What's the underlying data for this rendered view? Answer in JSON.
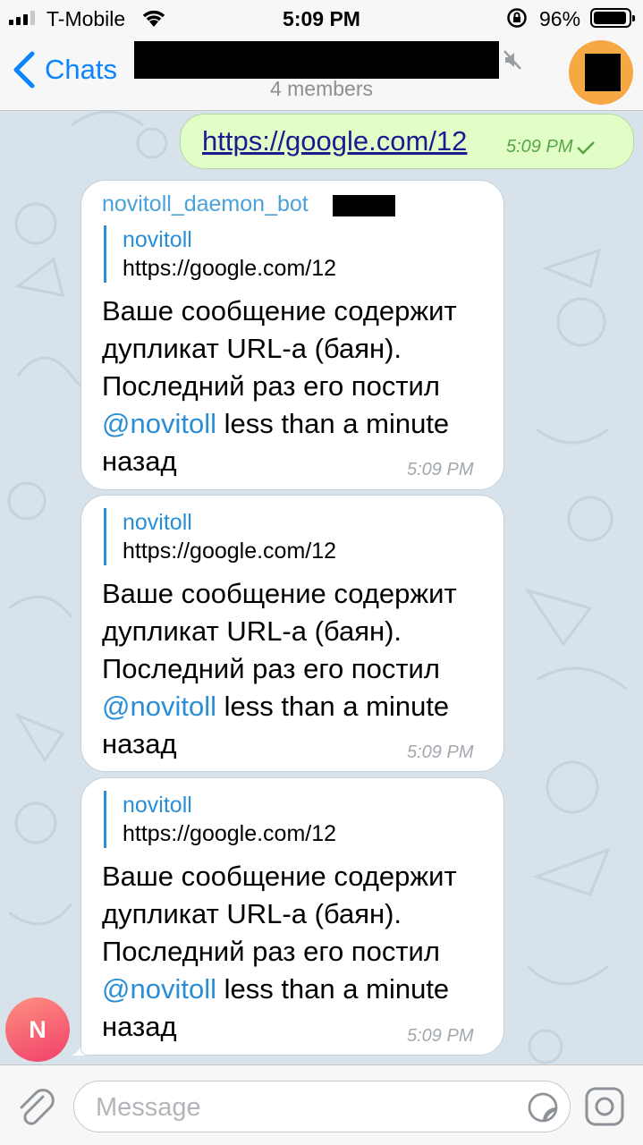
{
  "status_bar": {
    "carrier": "T-Mobile",
    "time": "5:09 PM",
    "battery_percent": "96%",
    "battery_level": 0.96
  },
  "nav": {
    "back_label": "Chats",
    "subtitle": "4 members",
    "icons": [
      "chevron-left-icon",
      "mute-icon",
      "avatar"
    ]
  },
  "messages": {
    "outgoing": {
      "text": "https://google.com/12",
      "time": "5:09 PM",
      "status_icon": "check-icon"
    },
    "incoming": [
      {
        "sender": "novitoll_daemon_bot",
        "reply_name": "novitoll",
        "reply_text": "https://google.com/12",
        "text_before": "Ваше сообщение содержит дупликат URL-а (баян). Последний раз его постил ",
        "mention": "@novitoll",
        "text_after": " less than a minute назад",
        "time": "5:09 PM"
      },
      {
        "reply_name": "novitoll",
        "reply_text": "https://google.com/12",
        "text_before": "Ваше сообщение содержит дупликат URL-а (баян). Последний раз его постил ",
        "mention": "@novitoll",
        "text_after": " less than a minute назад",
        "time": "5:09 PM"
      },
      {
        "reply_name": "novitoll",
        "reply_text": "https://google.com/12",
        "text_before": "Ваше сообщение содержит дупликат URL-а (баян). Последний раз его постил ",
        "mention": "@novitoll",
        "text_after": " less than a minute назад",
        "time": "5:09 PM"
      }
    ],
    "sender_avatar_letter": "N"
  },
  "input": {
    "placeholder": "Message",
    "value": ""
  },
  "colors": {
    "accent": "#0a84ff",
    "outgoing_bubble": "#e2fec7",
    "chat_background": "#d7e2ea",
    "avatar": "#f5a844",
    "sender_name": "#4aa2d9"
  }
}
